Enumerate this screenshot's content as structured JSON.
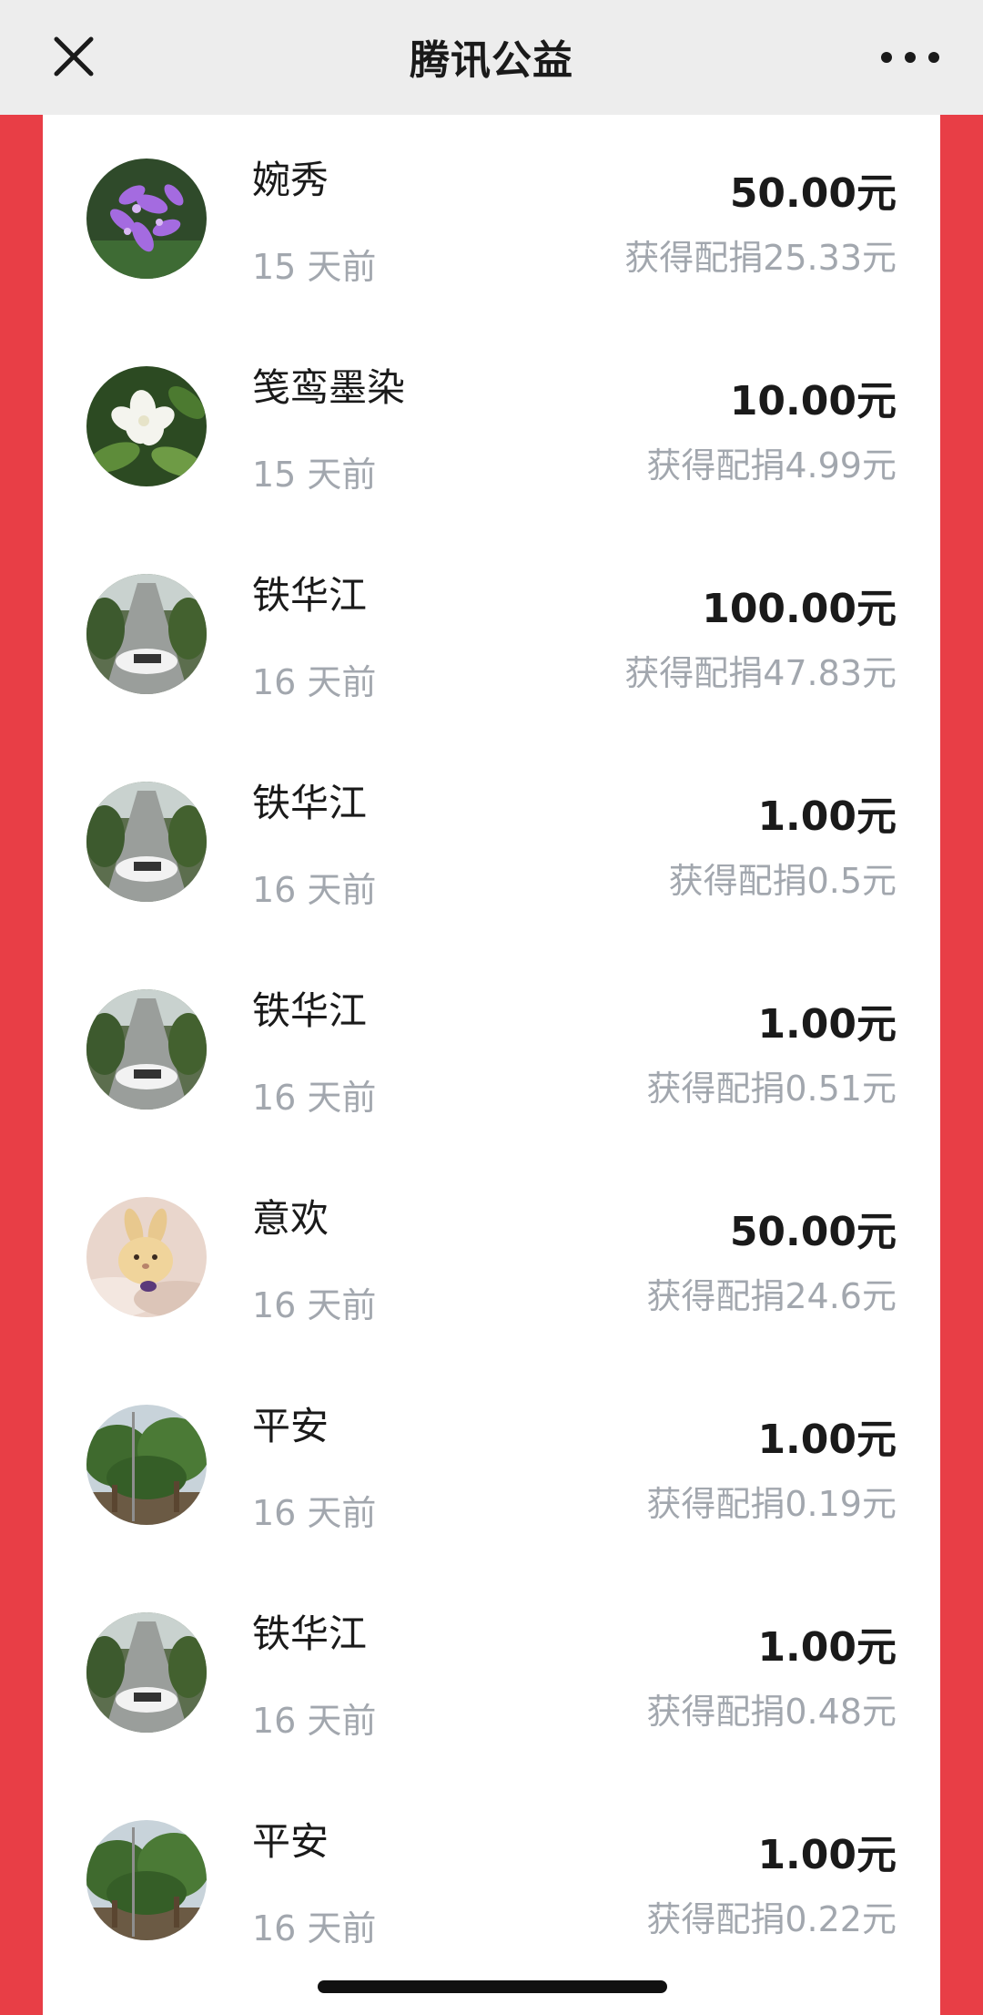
{
  "header": {
    "title": "腾讯公益",
    "close_icon": "close-icon",
    "more_icon": "more-icon"
  },
  "colors": {
    "accent_red": "#E83E46",
    "text_primary": "#1A1A1A",
    "text_secondary": "#A2A7AE"
  },
  "donations": [
    {
      "name": "婉秀",
      "time": "15 天前",
      "amount": "50.00元",
      "match": "获得配捐25.33元",
      "avatar": "purple-orchid-avatar"
    },
    {
      "name": "笺鸾墨染",
      "time": "15 天前",
      "amount": "10.00元",
      "match": "获得配捐4.99元",
      "avatar": "white-gardenia-avatar"
    },
    {
      "name": "铁华江",
      "time": "16 天前",
      "amount": "100.00元",
      "match": "获得配捐47.83元",
      "avatar": "road-scene-avatar"
    },
    {
      "name": "铁华江",
      "time": "16 天前",
      "amount": "1.00元",
      "match": "获得配捐0.5元",
      "avatar": "road-scene-avatar"
    },
    {
      "name": "铁华江",
      "time": "16 天前",
      "amount": "1.00元",
      "match": "获得配捐0.51元",
      "avatar": "road-scene-avatar"
    },
    {
      "name": "意欢",
      "time": "16 天前",
      "amount": "50.00元",
      "match": "获得配捐24.6元",
      "avatar": "plush-bunny-avatar"
    },
    {
      "name": "平安",
      "time": "16 天前",
      "amount": "1.00元",
      "match": "获得配捐0.19元",
      "avatar": "trees-avatar"
    },
    {
      "name": "铁华江",
      "time": "16 天前",
      "amount": "1.00元",
      "match": "获得配捐0.48元",
      "avatar": "road-scene-avatar"
    },
    {
      "name": "平安",
      "time": "16 天前",
      "amount": "1.00元",
      "match": "获得配捐0.22元",
      "avatar": "trees-avatar"
    }
  ]
}
